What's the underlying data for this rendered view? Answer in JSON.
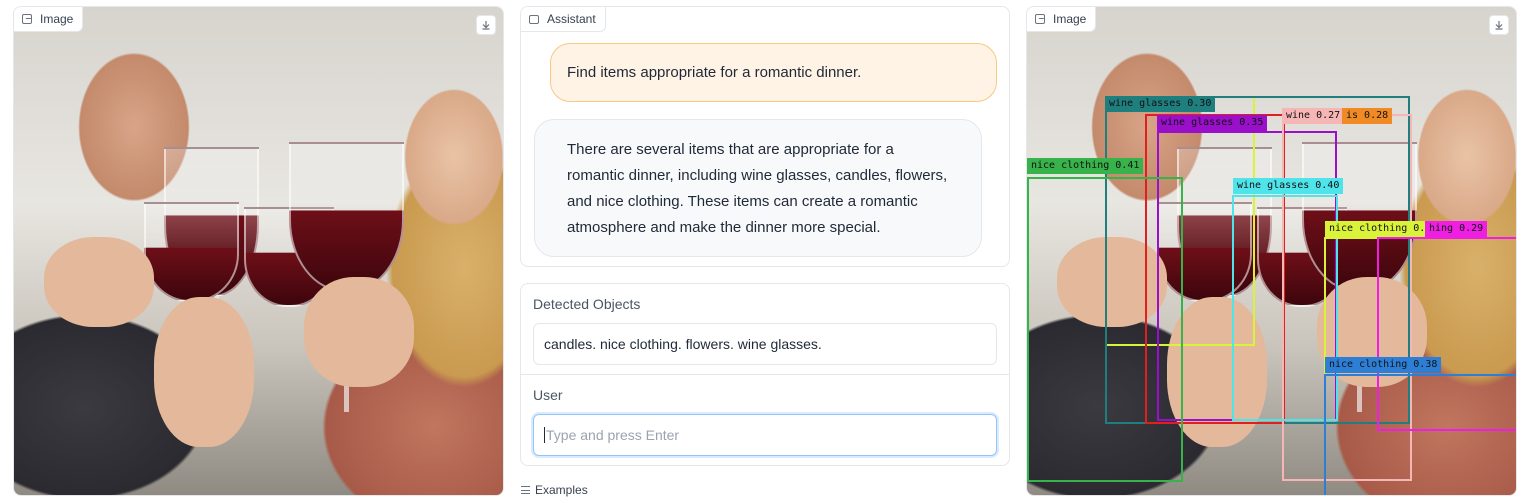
{
  "left_image": {
    "label": "Image",
    "download_icon": "download-icon"
  },
  "chat": {
    "label": "Assistant",
    "user_message": "Find items appropriate for a romantic dinner.",
    "assistant_message": "There are several items that are appropriate for a romantic dinner, including wine glasses, candles, flowers, and nice clothing. These items can create a romantic atmosphere and make the dinner more special."
  },
  "detected": {
    "label": "Detected Objects",
    "value": "candles. nice clothing. flowers. wine glasses."
  },
  "user_input": {
    "label": "User",
    "placeholder": "Type and press Enter"
  },
  "examples": {
    "label": "Examples"
  },
  "right_image": {
    "label": "Image",
    "detections": [
      {
        "text": "wine glasses 0.30",
        "color": "#1f7f7f"
      },
      {
        "text": "wine glasses 0.35",
        "color": "#9a0fc9"
      },
      {
        "text": "wine 0.27",
        "color": "#f6b6b6"
      },
      {
        "text": "is 0.28",
        "color": "#f08a24"
      },
      {
        "text": "nice clothing 0.41",
        "color": "#38b24a"
      },
      {
        "text": "wine glasses 0.40",
        "color": "#4fe3ea"
      },
      {
        "text": "nice clothing 0.28",
        "color": "#d9f23a"
      },
      {
        "text": "hing 0.29",
        "color": "#ee1fe3"
      },
      {
        "text": "nice clothing 0.38",
        "color": "#2d7fd6"
      }
    ]
  }
}
